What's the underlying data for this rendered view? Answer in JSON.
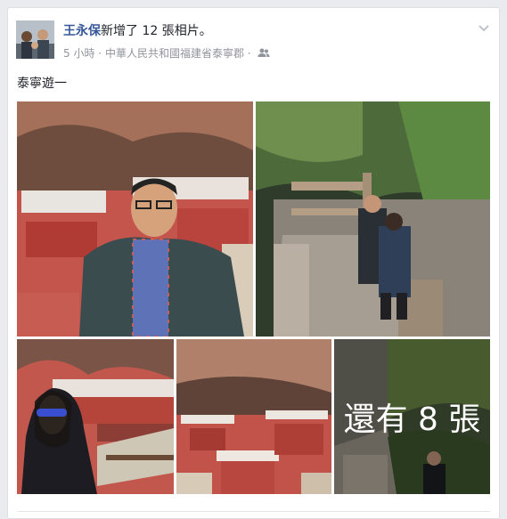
{
  "post": {
    "author": "王永保",
    "action": "新增了 12 張相片。",
    "time": "5 小時",
    "dot": "·",
    "location": "中華人民共和國福建省泰寧郡",
    "message": "泰寧遊一"
  },
  "icons": {
    "audience": "friends-icon",
    "menu": "chevron-down-icon"
  },
  "photos": {
    "more_label": "還有 8 張"
  },
  "colors": {
    "author": "#365899",
    "meta": "#90949c"
  }
}
